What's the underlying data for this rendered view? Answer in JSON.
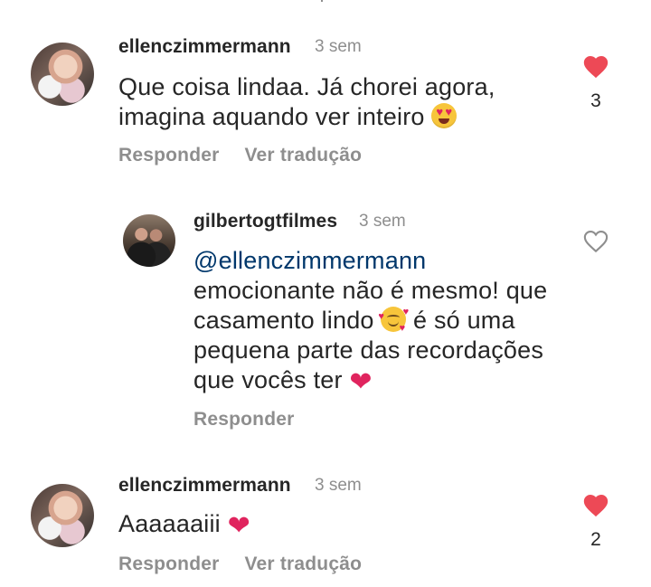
{
  "comments": [
    {
      "username": "ellenczimmermann",
      "time": "3 sem",
      "lines": [
        "Que coisa lindaa. Já chorei agora,",
        "imagina aquando ver inteiro"
      ],
      "emoji": "heart-eyes-emoji",
      "actions": [
        "Responder",
        "Ver tradução"
      ],
      "likes": "3",
      "liked": true
    },
    {
      "username": "gilbertogtfilmes",
      "time": "3 sem",
      "mention": "@ellenczimmermann",
      "lines": [
        "emocionante não é mesmo! que",
        "casamento lindo",
        "é só uma",
        "pequena parte das recordações",
        "que vocês ter"
      ],
      "emoji": "smiling-face-with-hearts-emoji",
      "actions": [
        "Responder"
      ],
      "liked": false
    },
    {
      "username": "ellenczimmermann",
      "time": "3 sem",
      "lines": [
        "Aaaaaaiii"
      ],
      "emoji": "red-heart-emoji",
      "actions": [
        "Responder",
        "Ver tradução"
      ],
      "likes": "2",
      "liked": true
    }
  ],
  "colors": {
    "like_red": "#ed4956",
    "muted": "#8e8e8e",
    "mention": "#00376b",
    "text": "#262626"
  }
}
